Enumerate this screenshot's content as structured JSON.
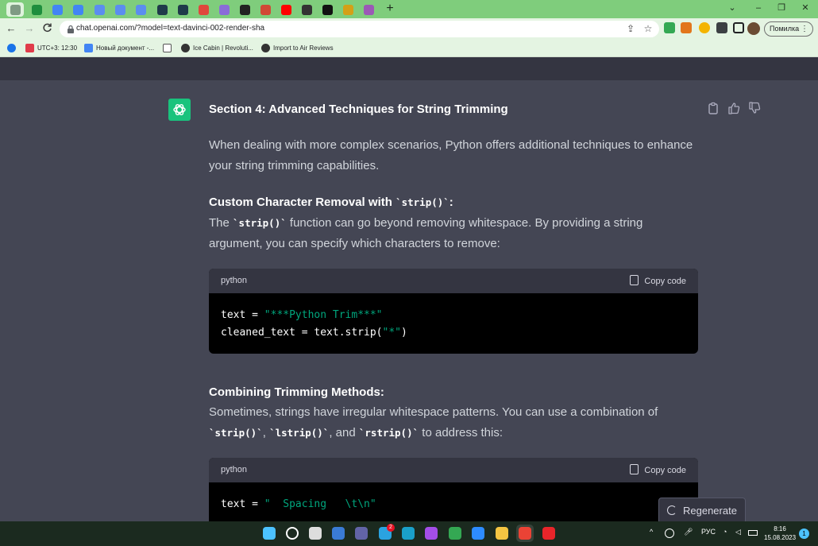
{
  "browser": {
    "tabs": [
      {
        "icon": "chatgpt-tab-icon",
        "color": "#7f9a84"
      },
      {
        "icon": "sheets-tab-icon",
        "color": "#1e8e3e"
      },
      {
        "icon": "docs-tab-icon",
        "color": "#4285f4"
      },
      {
        "icon": "docs-tab-icon",
        "color": "#4285f4"
      },
      {
        "icon": "translate-tab-icon",
        "color": "#5b8def"
      },
      {
        "icon": "translate-tab-icon",
        "color": "#5b8def"
      },
      {
        "icon": "translate-tab-icon",
        "color": "#5b8def"
      },
      {
        "icon": "hex-tab-icon",
        "color": "#1f3a4a"
      },
      {
        "icon": "hex-tab-icon",
        "color": "#1f3a4a"
      },
      {
        "icon": "target-tab-icon",
        "color": "#e0483c"
      },
      {
        "icon": "star-tab-icon",
        "color": "#8a6cd8"
      },
      {
        "icon": "glasses-tab-icon",
        "color": "#222222"
      },
      {
        "icon": "m-tab-icon",
        "color": "#d14836"
      },
      {
        "icon": "youtube-tab-icon",
        "color": "#ff0000"
      },
      {
        "icon": "p-tab-icon",
        "color": "#333333"
      },
      {
        "icon": "ai-tab-icon",
        "color": "#111111"
      },
      {
        "icon": "grid-tab-icon",
        "color": "#d4a017"
      },
      {
        "icon": "circle-tab-icon",
        "color": "#9b59b6"
      }
    ],
    "new_tab": "+",
    "window_controls": {
      "dropdown": "⌄",
      "minimize": "–",
      "restore": "❐",
      "close": "✕"
    },
    "nav": {
      "back": "←",
      "forward": "→",
      "reload": "C"
    },
    "url": "chat.openai.com/?model=text-davinci-002-render-sha",
    "profile_label": "Помилка",
    "bookmarks": [
      {
        "label": "",
        "icon": "settings-icon",
        "color": "#1a73e8"
      },
      {
        "label": "UTC+3: 12:30",
        "icon": "clock-bookmark-icon",
        "color": "#e03c4a"
      },
      {
        "label": "Новый документ -...",
        "icon": "docs-bookmark-icon",
        "color": "#4285f4"
      },
      {
        "label": "",
        "icon": "wave-bookmark-icon",
        "color": "#555555"
      },
      {
        "label": "Ice Cabin | Revoluti...",
        "icon": "globe-bookmark-icon",
        "color": "#333333"
      },
      {
        "label": "Import to Air Reviews",
        "icon": "globe-bookmark-icon",
        "color": "#333333"
      }
    ]
  },
  "chat": {
    "heading": "Section 4: Advanced Techniques for String Trimming",
    "intro_line1": "When dealing with more complex scenarios, Python offers additional techniques to enhance",
    "intro_line2": "your string trimming capabilities.",
    "sub1_title": "Custom Character Removal with ",
    "sub1_code": "`strip()`",
    "sub1_colon": ":",
    "p1_pre": "The ",
    "p1_code": "`strip()`",
    "p1_post": " function can go beyond removing whitespace. By providing a string",
    "p1_line2": "argument, you can specify which characters to remove:",
    "code1": {
      "lang": "python",
      "copy": "Copy code",
      "l1_a": "text = ",
      "l1_s": "\"***Python Trim***\"",
      "l2_a": "cleaned_text = text.strip(",
      "l2_s": "\"*\"",
      "l2_b": ")"
    },
    "sub2_title": "Combining Trimming Methods:",
    "p2_line1": "Sometimes, strings have irregular whitespace patterns. You can use a combination of",
    "p2_c1": "`strip()`",
    "p2_sep1": ", ",
    "p2_c2": "`lstrip()`",
    "p2_sep2": ", and ",
    "p2_c3": "`rstrip()`",
    "p2_end": " to address this:",
    "code2": {
      "lang": "python",
      "copy": "Copy code",
      "l1_a": "text = ",
      "l1_s": "\"  Spacing   \\t\\n\""
    },
    "regenerate": "Regenerate"
  },
  "taskbar": {
    "apps": [
      {
        "icon": "windows-start-icon",
        "color": "#4cc2ff"
      },
      {
        "icon": "search-icon",
        "color": "#ffffff"
      },
      {
        "icon": "task-view-icon",
        "color": "#dddddd"
      },
      {
        "icon": "widgets-icon",
        "color": "#3a7bd5"
      },
      {
        "icon": "chat-icon",
        "color": "#6264a7"
      },
      {
        "icon": "telegram-icon",
        "color": "#2aa3e0"
      },
      {
        "icon": "edge-icon",
        "color": "#1aa0c9"
      },
      {
        "icon": "messenger-icon",
        "color": "#a34ee8"
      },
      {
        "icon": "chrome-icon",
        "color": "#34a853"
      },
      {
        "icon": "zoom-icon",
        "color": "#2d8cff"
      },
      {
        "icon": "explorer-icon",
        "color": "#f4c542"
      },
      {
        "icon": "chrome-icon",
        "color": "#ea4335"
      },
      {
        "icon": "yandex-icon",
        "color": "#e8252a"
      }
    ],
    "telegram_badge": "2",
    "language": "РУС",
    "time": "8:16",
    "date": "15.08.2023",
    "notifications": "1"
  },
  "colors": {
    "accent": "#19c37d",
    "code_string": "#00a67d",
    "panel": "#444654"
  }
}
